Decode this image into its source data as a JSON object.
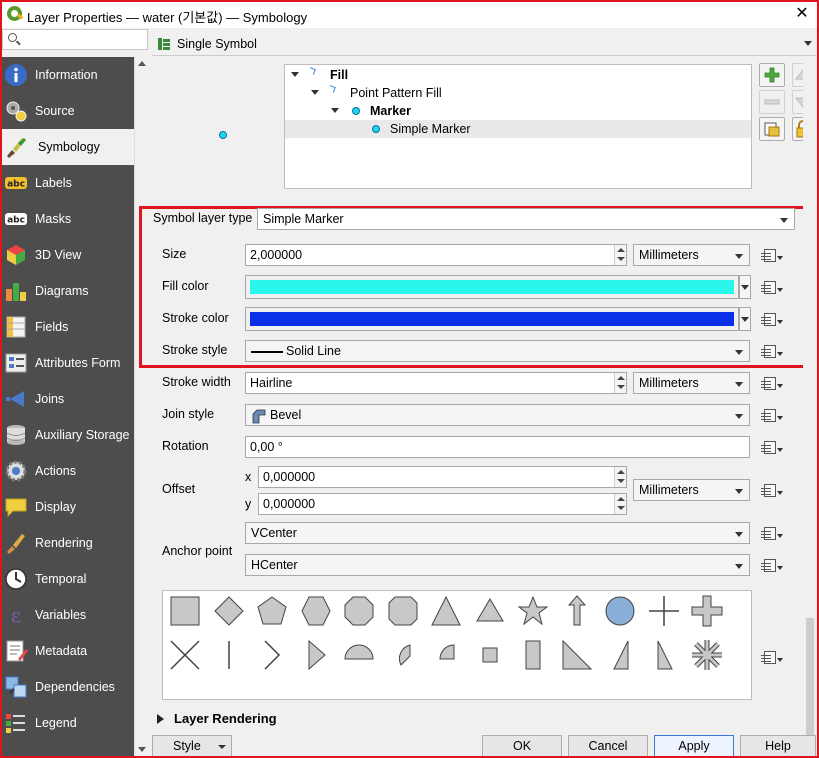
{
  "window": {
    "title": "Layer Properties — water (기본값) — Symbology",
    "close_glyph": "✕"
  },
  "sidebar": {
    "search_placeholder": "",
    "items": [
      {
        "label": "Information",
        "icon": "information-icon",
        "active": false
      },
      {
        "label": "Source",
        "icon": "source-icon",
        "active": false
      },
      {
        "label": "Symbology",
        "icon": "symbology-brush-icon",
        "active": true
      },
      {
        "label": "Labels",
        "icon": "labels-abc-icon",
        "active": false
      },
      {
        "label": "Masks",
        "icon": "masks-abc-icon",
        "active": false
      },
      {
        "label": "3D View",
        "icon": "3d-cube-icon",
        "active": false
      },
      {
        "label": "Diagrams",
        "icon": "diagrams-icon",
        "active": false
      },
      {
        "label": "Fields",
        "icon": "fields-icon",
        "active": false
      },
      {
        "label": "Attributes Form",
        "icon": "attributes-form-icon",
        "active": false
      },
      {
        "label": "Joins",
        "icon": "joins-icon",
        "active": false
      },
      {
        "label": "Auxiliary Storage",
        "icon": "auxiliary-storage-icon",
        "active": false
      },
      {
        "label": "Actions",
        "icon": "actions-gear-icon",
        "active": false
      },
      {
        "label": "Display",
        "icon": "display-speech-icon",
        "active": false
      },
      {
        "label": "Rendering",
        "icon": "rendering-brush-icon",
        "active": false
      },
      {
        "label": "Temporal",
        "icon": "temporal-clock-icon",
        "active": false
      },
      {
        "label": "Variables",
        "icon": "variables-epsilon-icon",
        "active": false
      },
      {
        "label": "Metadata",
        "icon": "metadata-icon",
        "active": false
      },
      {
        "label": "Dependencies",
        "icon": "dependencies-icon",
        "active": false
      },
      {
        "label": "Legend",
        "icon": "legend-icon",
        "active": false
      }
    ]
  },
  "renderer": {
    "mode": "Single Symbol"
  },
  "symbol_tree": {
    "rows": [
      {
        "label": "Fill",
        "bold": true
      },
      {
        "label": "Point Pattern Fill",
        "bold": false
      },
      {
        "label": "Marker",
        "bold": true
      },
      {
        "label": "Simple Marker",
        "bold": false,
        "selected": true
      }
    ]
  },
  "form": {
    "symbol_layer_type_label": "Symbol layer type",
    "symbol_layer_type_value": "Simple Marker",
    "size_label": "Size",
    "size_value": "2,000000",
    "size_unit": "Millimeters",
    "fill_color_label": "Fill color",
    "fill_color": "#2af5ea",
    "stroke_color_label": "Stroke color",
    "stroke_color": "#0b2ee8",
    "stroke_style_label": "Stroke style",
    "stroke_style_value": "Solid Line",
    "stroke_width_label": "Stroke width",
    "stroke_width_value": "Hairline",
    "stroke_width_unit": "Millimeters",
    "join_style_label": "Join style",
    "join_style_value": "Bevel",
    "rotation_label": "Rotation",
    "rotation_value": "0,00 °",
    "offset_label": "Offset",
    "offset_x_label": "x",
    "offset_x_value": "0,000000",
    "offset_y_label": "y",
    "offset_y_value": "0,000000",
    "offset_unit": "Millimeters",
    "anchor_label": "Anchor point",
    "anchor_v": "VCenter",
    "anchor_h": "HCenter"
  },
  "shapes": [
    "square",
    "diamond",
    "pentagon",
    "hexagon",
    "octagon",
    "rounded-square",
    "triangle",
    "equilateral-triangle",
    "star",
    "arrow",
    "circle",
    "cross-thin",
    "cross-fill",
    "cross-x",
    "line",
    "arrowhead",
    "filled-arrowhead",
    "semi-circle",
    "third-circle",
    "quarter-circle",
    "small-square",
    "rectangle",
    "right-half-triangle",
    "left-half-triangle",
    "half-triangle",
    "asterisk"
  ],
  "colors": {
    "sidebar_bg": "#4d4d4d",
    "highlight_border": "#e0141e",
    "marker_fill": "#19d8e8",
    "shape_fill": "#c8c8c8"
  },
  "footer": {
    "layer_rendering": "Layer Rendering",
    "style_button": "Style",
    "ok_button": "OK",
    "cancel_button": "Cancel",
    "apply_button": "Apply",
    "help_button": "Help"
  }
}
